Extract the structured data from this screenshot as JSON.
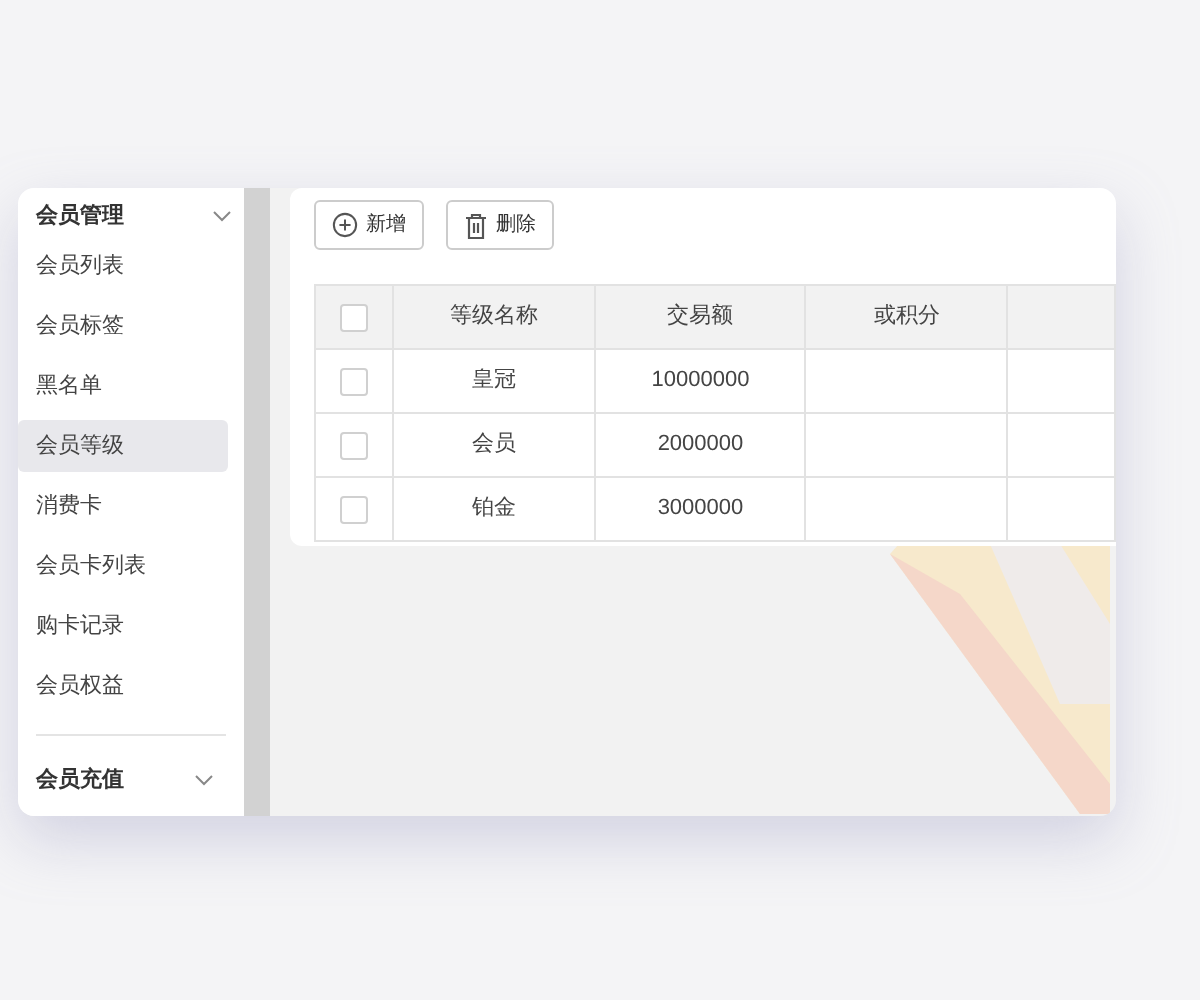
{
  "sidebar": {
    "groups": [
      {
        "title": "会员管理",
        "items": [
          {
            "label": "会员列表",
            "selected": false
          },
          {
            "label": "会员标签",
            "selected": false
          },
          {
            "label": "黑名单",
            "selected": false
          },
          {
            "label": "会员等级",
            "selected": true
          },
          {
            "label": "消费卡",
            "selected": false
          },
          {
            "label": "会员卡列表",
            "selected": false
          },
          {
            "label": "购卡记录",
            "selected": false
          },
          {
            "label": "会员权益",
            "selected": false
          }
        ]
      },
      {
        "title": "会员充值"
      }
    ]
  },
  "toolbar": [
    {
      "kind": "add",
      "label": "新增"
    },
    {
      "kind": "delete",
      "label": "删除"
    }
  ],
  "table": {
    "columns": [
      "等级名称",
      "交易额",
      "或积分"
    ],
    "header_checked": false,
    "rows": [
      {
        "checked": false,
        "cells": [
          "皇冠",
          "10000000",
          ""
        ]
      },
      {
        "checked": false,
        "cells": [
          "会员",
          "2000000",
          ""
        ]
      },
      {
        "checked": false,
        "cells": [
          "铂金",
          "3000000",
          ""
        ]
      }
    ]
  }
}
